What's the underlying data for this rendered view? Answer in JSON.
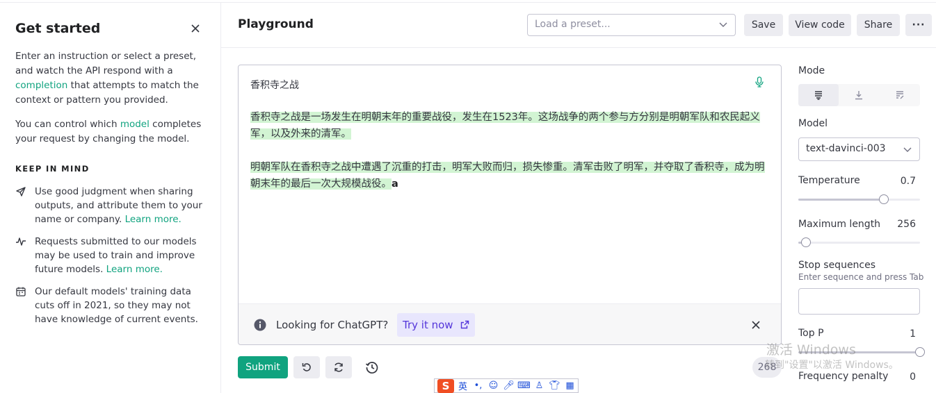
{
  "sidebar": {
    "title": "Get started",
    "intro_before": "Enter an instruction or select a preset, and watch the API respond with a ",
    "intro_link": "completion",
    "intro_after": " that attempts to match the context or pattern you provided.",
    "model_before": "You can control which ",
    "model_link": "model",
    "model_after": " completes your request by changing the model.",
    "keep_heading": "KEEP IN MIND",
    "tips": [
      {
        "icon": "send-icon",
        "text": "Use good judgment when sharing outputs, and attribute them to your name or company. ",
        "link": "Learn more."
      },
      {
        "icon": "activity-icon",
        "text": "Requests submitted to our models may be used to train and improve future models. ",
        "link": "Learn more."
      },
      {
        "icon": "calendar-icon",
        "text": "Our default models' training data cuts off in 2021, so they may not have knowledge of current events.",
        "link": ""
      }
    ]
  },
  "header": {
    "title": "Playground",
    "preset_placeholder": "Load a preset...",
    "save_label": "Save",
    "view_code_label": "View code",
    "share_label": "Share",
    "more_label": "···"
  },
  "editor": {
    "prompt_title": "香积寺之战",
    "completion_p1": "香积寺之战是一场发生在明朝末年的重要战役，发生在1523年。这场战争的两个参与方分别是明朝军队和农民起义军，以及外来的清军。",
    "completion_p2": "明朝军队在香积寺之战中遭遇了沉重的打击，明军大败而归，损失惨重。清军击败了明军，并夺取了香积寺，成为明朝末年的最后一次大规模战役。",
    "cursor_char": "a",
    "banner_text": "Looking for ChatGPT?",
    "banner_link": "Try it now"
  },
  "footer": {
    "submit_label": "Submit",
    "token_count": "268"
  },
  "ime": {
    "logo": "S",
    "lang": "英"
  },
  "settings": {
    "mode_label": "Mode",
    "modes": [
      "complete",
      "insert",
      "edit"
    ],
    "active_mode": "complete",
    "model_label": "Model",
    "model_value": "text-davinci-003",
    "temperature_label": "Temperature",
    "temperature_value": "0.7",
    "temperature_fraction": 0.7,
    "max_length_label": "Maximum length",
    "max_length_value": "256",
    "max_length_fraction": 0.06,
    "stop_label": "Stop sequences",
    "stop_hint": "Enter sequence and press Tab",
    "top_p_label": "Top P",
    "top_p_value": "1",
    "top_p_fraction": 1.0,
    "freq_label": "Frequency penalty",
    "freq_value": "0"
  },
  "watermark": {
    "line1": "激活 Windows",
    "line2": "转到\"设置\"以激活 Windows。"
  },
  "colors": {
    "accent": "#10a37f",
    "highlight": "#d2f4d3",
    "banner_link": "#5436da"
  }
}
